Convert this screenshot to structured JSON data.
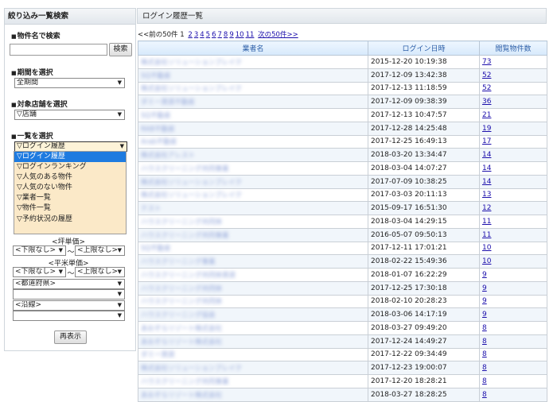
{
  "sidebar": {
    "title": "絞り込み一覧検索",
    "name_search": {
      "label": "物件名で検索",
      "value": "",
      "button": "検索"
    },
    "period": {
      "label": "期間を選択",
      "selected": "全期間"
    },
    "store": {
      "label": "対象店舗を選択",
      "selected": "▽店舗"
    },
    "list": {
      "label": "一覧を選択",
      "selected": "▽ログイン履歴",
      "options": [
        "▽ログイン履歴",
        "▽ログインランキング",
        "▽人気のある物件",
        "▽人気のない物件",
        "▽業者一覧",
        "▽物件一覧",
        "▽予約状況の履歴"
      ]
    },
    "tsubo": {
      "label": "<坪単価>",
      "lower": "<下限なし>",
      "sep": "～",
      "upper": "<上限なし>"
    },
    "heibei": {
      "label": "<平米単価>",
      "lower": "<下限なし>",
      "sep": "～",
      "upper": "<上限なし>"
    },
    "prefecture": "<都道府県>",
    "line": "<沿線>",
    "refresh_button": "再表示"
  },
  "main": {
    "title": "ログイン履歴一覧",
    "pager": {
      "prev": "<<前の50件",
      "current": "1",
      "pages": [
        "2",
        "3",
        "4",
        "5",
        "6",
        "7",
        "8",
        "9",
        "10",
        "11"
      ],
      "next": "次の50件>>"
    },
    "columns": [
      "業者名",
      "ログイン日時",
      "閲覧物件数"
    ],
    "rows": [
      {
        "vendor": "株式会社ソリューションブレイク",
        "date": "2015-12-20 10:19:38",
        "count": "73"
      },
      {
        "vendor": "SQ不動産",
        "date": "2017-12-09 13:42:38",
        "count": "52"
      },
      {
        "vendor": "株式会社ソリューションブレイク",
        "date": "2017-12-13 11:18:59",
        "count": "52"
      },
      {
        "vendor": "ダミー賃貸不動産",
        "date": "2017-12-09 09:38:39",
        "count": "36"
      },
      {
        "vendor": "SQ不動産",
        "date": "2017-12-13 10:47:57",
        "count": "21"
      },
      {
        "vendor": "RAB不動産",
        "date": "2017-12-28 14:25:48",
        "count": "19"
      },
      {
        "vendor": "Arab不動産",
        "date": "2017-12-25 16:49:13",
        "count": "17"
      },
      {
        "vendor": "株式会社アレスト",
        "date": "2018-03-20 13:34:47",
        "count": "14"
      },
      {
        "vendor": "ハウスクリーニング共同事業",
        "date": "2018-03-04 14:07:27",
        "count": "14"
      },
      {
        "vendor": "株式会社ソリューションブレイク",
        "date": "2017-07-09 10:38:25",
        "count": "14"
      },
      {
        "vendor": "株式会社ソリューションブレイク",
        "date": "2017-03-03 20:11:13",
        "count": "13"
      },
      {
        "vendor": "テスト",
        "date": "2015-09-17 16:51:30",
        "count": "12"
      },
      {
        "vendor": "ハウスクリーニング共同体",
        "date": "2018-03-04 14:29:15",
        "count": "11"
      },
      {
        "vendor": "ハウスクリーニング共同事業",
        "date": "2016-05-07 09:50:13",
        "count": "11"
      },
      {
        "vendor": "SQ不動産",
        "date": "2017-12-11 17:01:21",
        "count": "10"
      },
      {
        "vendor": "ハウスクリーニング事業",
        "date": "2018-02-22 15:49:36",
        "count": "10"
      },
      {
        "vendor": "ハウスクリーニング共同体賃貸",
        "date": "2018-01-07 16:22:29",
        "count": "9"
      },
      {
        "vendor": "ハウスクリーニング共同体",
        "date": "2017-12-25 17:30:18",
        "count": "9"
      },
      {
        "vendor": "ハウスクリーニング共同体",
        "date": "2018-02-10 20:28:23",
        "count": "9"
      },
      {
        "vendor": "ハウスクリーニング協会",
        "date": "2018-03-06 14:17:19",
        "count": "9"
      },
      {
        "vendor": "あおぞらリゾート株式会社",
        "date": "2018-03-27 09:49:20",
        "count": "8"
      },
      {
        "vendor": "あおぞらリゾート株式会社",
        "date": "2017-12-24 14:49:27",
        "count": "8"
      },
      {
        "vendor": "ダミー賃貸",
        "date": "2017-12-22 09:34:49",
        "count": "8"
      },
      {
        "vendor": "株式会社ソリューションブレイク",
        "date": "2017-12-23 19:00:07",
        "count": "8"
      },
      {
        "vendor": "ハウスクリーニング共同事業",
        "date": "2017-12-20 18:28:21",
        "count": "8"
      },
      {
        "vendor": "あおぞらリゾート株式会社",
        "date": "2018-03-27 18:28:25",
        "count": "8"
      }
    ]
  }
}
